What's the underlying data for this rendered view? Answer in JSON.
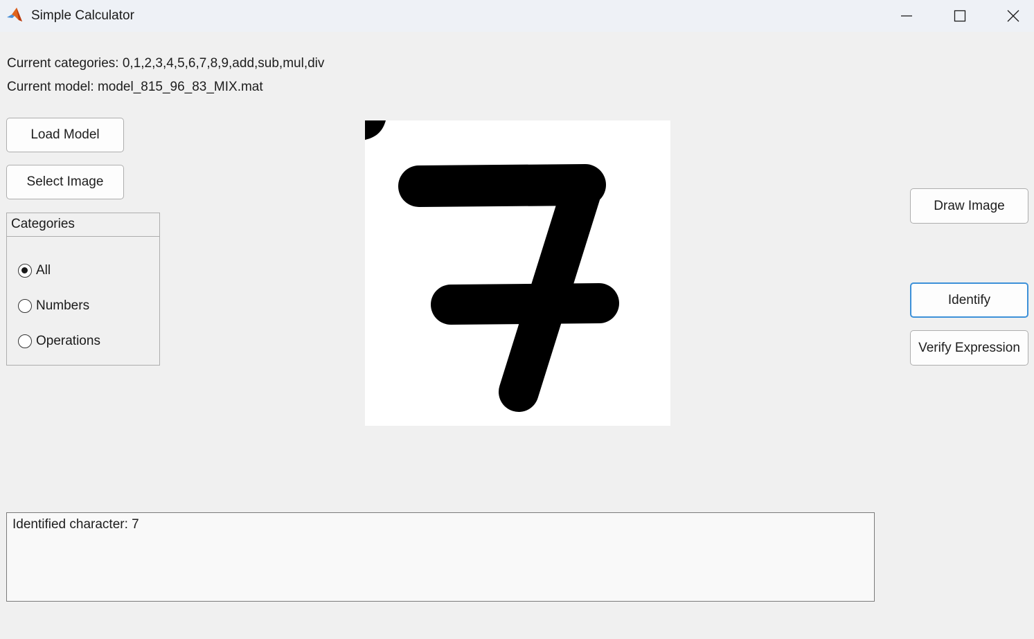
{
  "window": {
    "title": "Simple Calculator"
  },
  "info": {
    "categories_text": "Current categories: 0,1,2,3,4,5,6,7,8,9,add,sub,mul,div",
    "model_text": "Current model: model_815_96_83_MIX.mat"
  },
  "buttons": {
    "load_model": "Load Model",
    "select_image": "Select Image",
    "draw_image": "Draw Image",
    "identify": "Identify",
    "verify_expression": "Verify Expression"
  },
  "categories_panel": {
    "title": "Categories",
    "options": [
      {
        "label": "All",
        "selected": true
      },
      {
        "label": "Numbers",
        "selected": false
      },
      {
        "label": "Operations",
        "selected": false
      }
    ]
  },
  "image_display": {
    "depicted_character": "7"
  },
  "output": {
    "text": "Identified character: 7"
  },
  "colors": {
    "accent": "#3c90d8",
    "background": "#f0f0f0",
    "titlebar": "#eef1f6"
  }
}
